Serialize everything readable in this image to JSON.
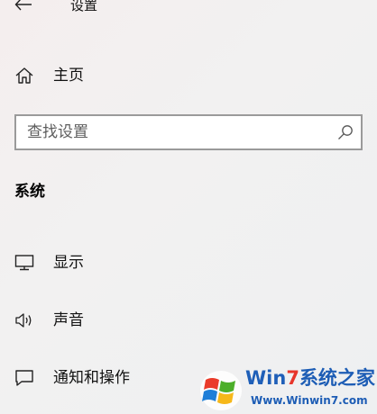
{
  "window": {
    "title": "设置"
  },
  "nav": {
    "home_label": "主页"
  },
  "search": {
    "placeholder": "查找设置",
    "value": ""
  },
  "section": {
    "title": "系统"
  },
  "menu": {
    "items": [
      {
        "label": "显示",
        "icon": "monitor-icon"
      },
      {
        "label": "声音",
        "icon": "speaker-icon"
      },
      {
        "label": "通知和操作",
        "icon": "notification-icon"
      }
    ]
  },
  "watermark": {
    "brand_win": "Win",
    "brand_seven": "7",
    "brand_rest": "系统之家",
    "url": "Www.Winwin7.com"
  }
}
